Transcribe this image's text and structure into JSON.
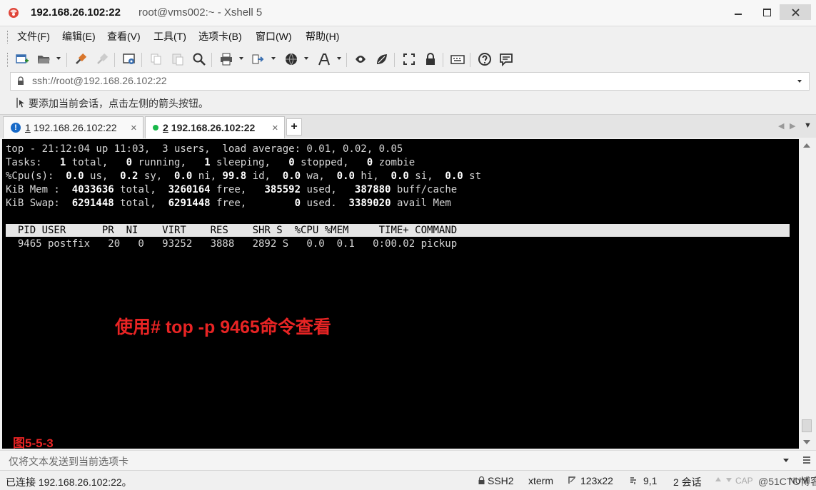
{
  "window": {
    "title_host": "192.168.26.102:22",
    "title_rest": "root@vms002:~ - Xshell 5"
  },
  "menu": [
    "文件(F)",
    "编辑(E)",
    "查看(V)",
    "工具(T)",
    "选项卡(B)",
    "窗口(W)",
    "帮助(H)"
  ],
  "address": {
    "value": "ssh://root@192.168.26.102:22"
  },
  "hint": {
    "text": "要添加当前会话，点击左侧的箭头按钮。"
  },
  "tabs": [
    {
      "num": "1",
      "label": "192.168.26.102:22"
    },
    {
      "num": "2",
      "label": "192.168.26.102:22"
    }
  ],
  "tab_add": "+",
  "terminal": {
    "line1": {
      "a": "top - 21:12:04 up 11:03,  3 users,  load average: 0.01, 0.02, 0.05"
    },
    "line2": {
      "p0": "Tasks:   ",
      "v1": "1",
      "p1": " total,   ",
      "v2": "0",
      "p2": " running,   ",
      "v3": "1",
      "p3": " sleeping,   ",
      "v4": "0",
      "p4": " stopped,   ",
      "v5": "0",
      "p5": " zombie"
    },
    "line3": {
      "p0": "%Cpu(s):  ",
      "v1": "0.0",
      "p1": " us,  ",
      "v2": "0.2",
      "p2": " sy,  ",
      "v3": "0.0",
      "p3": " ni, ",
      "v4": "99.8",
      "p4": " id,  ",
      "v5": "0.0",
      "p5": " wa,  ",
      "v6": "0.0",
      "p6": " hi,  ",
      "v7": "0.0",
      "p7": " si,  ",
      "v8": "0.0",
      "p8": " st"
    },
    "line4": {
      "p0": "KiB Mem :  ",
      "v1": "4033636",
      "p1": " total,  ",
      "v2": "3260164",
      "p2": " free,   ",
      "v3": "385592",
      "p3": " used,   ",
      "v4": "387880",
      "p4": " buff/cache"
    },
    "line5": {
      "p0": "KiB Swap:  ",
      "v1": "6291448",
      "p1": " total,  ",
      "v2": "6291448",
      "p2": " free,        ",
      "v3": "0",
      "p3": " used.  ",
      "v4": "3389020",
      "p4": " avail Mem"
    },
    "header": "  PID USER      PR  NI    VIRT    RES    SHR S  %CPU %MEM     TIME+ COMMAND",
    "row1": "  9465 postfix   20   0   93252   3888   2892 S   0.0  0.1   0:00.02 pickup"
  },
  "overlay_note": "使用# top -p 9465命令查看",
  "figure_label": "图5-5-3",
  "send_bar": {
    "placeholder": "仅将文本发送到当前选项卡"
  },
  "status": {
    "connection": "已连接 192.168.26.102:22。",
    "protocol": "SSH2",
    "terminal_type": "xterm",
    "size": "123x22",
    "cursor": "9,1",
    "sessions": "2 会话",
    "caps": "CAP",
    "num": "NUM",
    "watermark": "@51CTO博客"
  },
  "colors": {
    "terminal_bg": "#000000",
    "terminal_fg": "#d6d6d6",
    "annotation_red": "#e82424",
    "connected_green": "#19b84a",
    "warn_blue": "#1769c7"
  },
  "icons": {
    "app": "xshell-logo-icon",
    "tab1": "info-icon",
    "tab2": "connected-dot-icon"
  }
}
